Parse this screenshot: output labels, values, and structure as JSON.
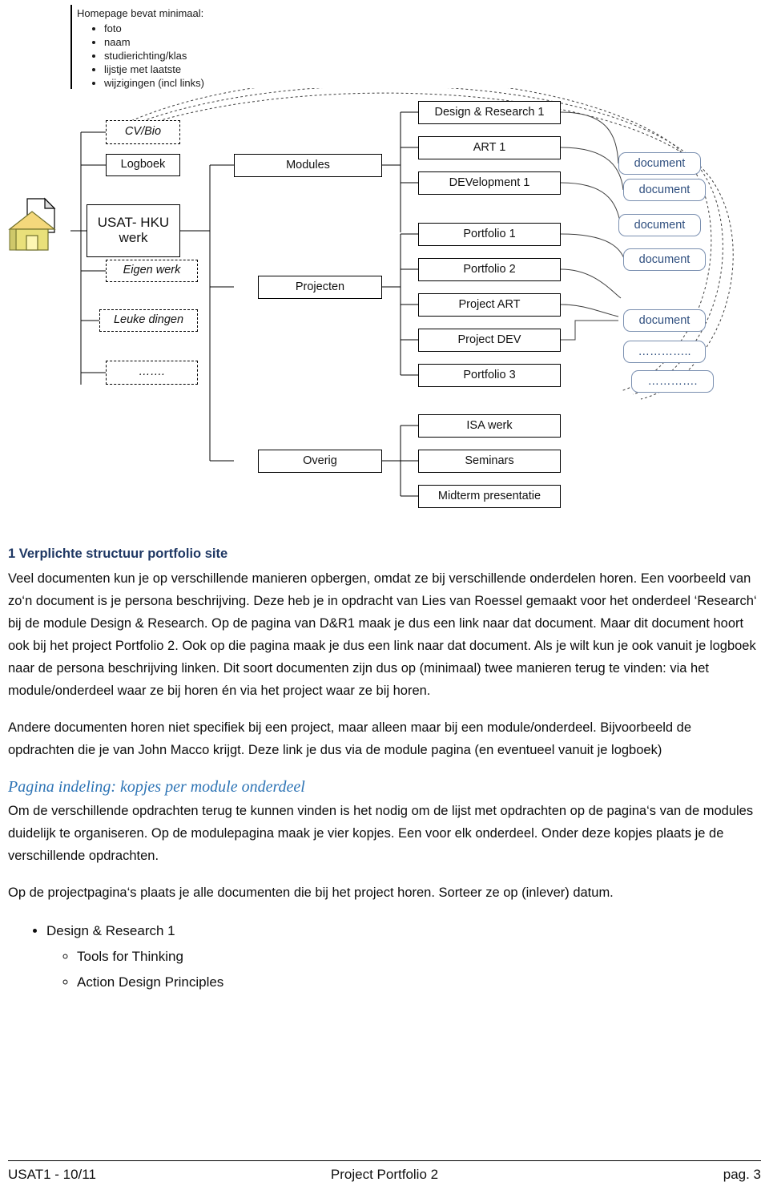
{
  "annotation": {
    "title": "Homepage bevat minimaal:",
    "items": [
      "foto",
      "naam",
      "studierichting/klas",
      "lijstje met laatste",
      "wijzigingen (incl links)"
    ]
  },
  "diagram": {
    "nodes": {
      "cv_bio": "CV/Bio",
      "logboek": "Logboek",
      "usat_hku_werk": "USAT- HKU werk",
      "eigen_werk": "Eigen werk",
      "leuke_dingen": "Leuke dingen",
      "dots_left": "…….",
      "modules": "Modules",
      "projecten": "Projecten",
      "overig": "Overig",
      "design_research_1": "Design & Research 1",
      "art_1": "ART 1",
      "development_1": "DEVelopment 1",
      "portfolio_1": "Portfolio 1",
      "portfolio_2": "Portfolio 2",
      "project_art": "Project ART",
      "project_dev": "Project DEV",
      "portfolio_3": "Portfolio 3",
      "isa_werk": "ISA werk",
      "seminars": "Seminars",
      "midterm_presentatie": "Midterm presentatie"
    },
    "documents": [
      "document",
      "document",
      "document",
      "document",
      "document"
    ],
    "document_dots": [
      "…………..",
      "…………."
    ]
  },
  "body": {
    "heading": "1 Verplichte structuur portfolio site",
    "paragraph_1": "Veel documenten kun je op verschillende manieren opbergen, omdat ze bij verschillende onderdelen horen. Een voorbeeld van zo‘n document is je persona beschrijving. Deze heb je in opdracht van Lies van Roessel gemaakt voor het onderdeel ‘Research‘ bij de module Design & Research. Op de pagina van D&R1 maak je dus een link naar dat document. Maar dit document hoort ook bij het project Portfolio 2. Ook op die pagina maak je dus een link naar dat document. Als je wilt kun je ook vanuit je logboek naar de persona beschrijving linken. Dit soort documenten zijn dus op (minimaal) twee manieren terug te vinden: via het module/onderdeel waar ze bij horen én  via het project waar ze bij horen.",
    "paragraph_2": "Andere documenten horen niet specifiek bij een project, maar alleen maar bij een module/onderdeel. Bijvoorbeeld de opdrachten die je van John Macco krijgt. Deze link je dus via de module pagina (en eventueel vanuit je logboek)",
    "section_heading": "Pagina indeling: kopjes per module onderdeel",
    "paragraph_3": "Om de verschillende opdrachten terug te kunnen vinden is het nodig om de lijst met opdrachten op de pagina‘s van de modules duidelijk te organiseren. Op de modulepagina maak je vier kopjes. Een voor elk onderdeel. Onder deze kopjes plaats je de verschillende opdrachten.",
    "paragraph_4": "Op de projectpagina‘s plaats je alle documenten die bij het project horen. Sorteer ze op (inlever) datum.",
    "list": {
      "item": "Design & Research 1",
      "subitems": [
        "Tools for Thinking",
        "Action Design Principles"
      ]
    }
  },
  "footer": {
    "left": "USAT1 - 10/11",
    "center": "Project Portfolio 2",
    "right": "pag. 3"
  }
}
